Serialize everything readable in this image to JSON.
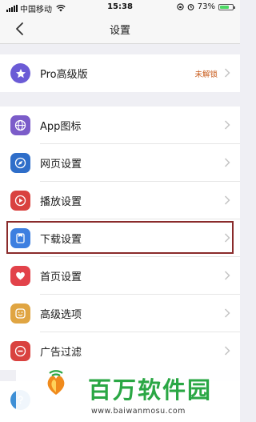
{
  "status_bar": {
    "carrier": "中国移动",
    "time": "15:38",
    "battery": "73%",
    "battery_level": 0.73
  },
  "navbar": {
    "title": "设置",
    "back_icon": "chevron-left-icon"
  },
  "pro_section": {
    "label": "Pro高级版",
    "status": "未解锁",
    "icon": "star-icon",
    "icon_color": "#6b5bd6"
  },
  "settings": [
    {
      "label": "App图标",
      "icon": "globe-icon",
      "color": "#7b5cc9"
    },
    {
      "label": "网页设置",
      "icon": "compass-icon",
      "color": "#2f6ec9"
    },
    {
      "label": "播放设置",
      "icon": "play-icon",
      "color": "#d9423f"
    },
    {
      "label": "下载设置",
      "icon": "download-icon",
      "color": "#3d7fe0"
    },
    {
      "label": "首页设置",
      "icon": "heart-icon",
      "color": "#e2424a"
    },
    {
      "label": "高级选项",
      "icon": "smile-icon",
      "color": "#e0a542"
    },
    {
      "label": "广告过滤",
      "icon": "minus-circle-icon",
      "color": "#d9423f"
    }
  ],
  "watermark": {
    "title": "百万软件园",
    "url": "www.baiwanmosu.com"
  }
}
